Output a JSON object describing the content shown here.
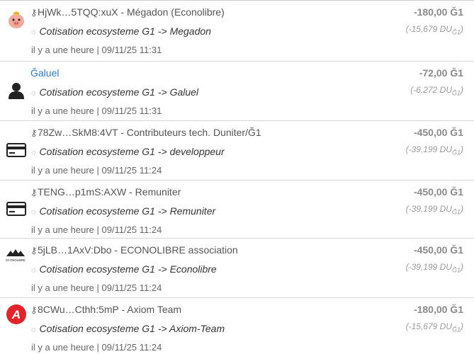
{
  "transactions": [
    {
      "avatar_icon": "piggy-bank-icon",
      "name": "HjWk…5TQQ:xuX - Mégadon (Econolibre)",
      "comment": "Cotisation ecosysteme G1 -> Megadon",
      "time": "il y a une heure | 09/11/25 11:31",
      "amount": "-180,00 Ğ1",
      "amount_ud": "(-15,679 DU",
      "amount_ud_sub": "Ğ1",
      "amount_ud_end": ")"
    },
    {
      "avatar_icon": "user-icon",
      "name": "Ğaluel",
      "comment": "Cotisation ecosysteme G1 -> Galuel",
      "time": "il y a une heure | 09/11/25 11:31",
      "amount": "-72,00 Ğ1",
      "amount_ud": "(-6,272 DU",
      "amount_ud_sub": "Ğ1",
      "amount_ud_end": ")"
    },
    {
      "avatar_icon": "credit-card-icon",
      "name": "78Zw…SkM8:4VT - Contributeurs tech. Duniter/Ğ1",
      "comment": "Cotisation ecosysteme G1 -> developpeur",
      "time": "il y a une heure | 09/11/25 11:24",
      "amount": "-450,00 Ğ1",
      "amount_ud": "(-39,199 DU",
      "amount_ud_sub": "Ğ1",
      "amount_ud_end": ")"
    },
    {
      "avatar_icon": "credit-card-icon",
      "name": "TENG…p1mS:AXW - Remuniter",
      "comment": "Cotisation ecosysteme G1 -> Remuniter",
      "time": "il y a une heure | 09/11/25 11:24",
      "amount": "-450,00 Ğ1",
      "amount_ud": "(-39,199 DU",
      "amount_ud_sub": "Ğ1",
      "amount_ud_end": ")"
    },
    {
      "avatar_icon": "econolibre-logo",
      "name": "5jLB…1AxV:Dbo - ECONOLIBRE association",
      "comment": "Cotisation ecosysteme G1 -> Econolibre",
      "time": "il y a une heure | 09/11/25 11:24",
      "amount": "-450,00 Ğ1",
      "amount_ud": "(-39,199 DU",
      "amount_ud_sub": "Ğ1",
      "amount_ud_end": ")"
    },
    {
      "avatar_icon": "axiom-logo",
      "name": "8CWu…Cthh:5mP - Axiom Team",
      "comment": "Cotisation ecosysteme G1 -> Axiom-Team",
      "time": "il y a une heure | 09/11/25 11:24",
      "amount": "-180,00 Ğ1",
      "amount_ud": "(-15,679 DU",
      "amount_ud_sub": "Ğ1",
      "amount_ud_end": ")"
    }
  ],
  "logo_text": {
    "econolibre": "ECONOLIBRE",
    "axiom": "A"
  },
  "colors": {
    "link": "#2c7bd0",
    "amount": "#8a8a8a",
    "axiom_red": "#e0242a",
    "piggy_pink": "#f3a99c"
  }
}
